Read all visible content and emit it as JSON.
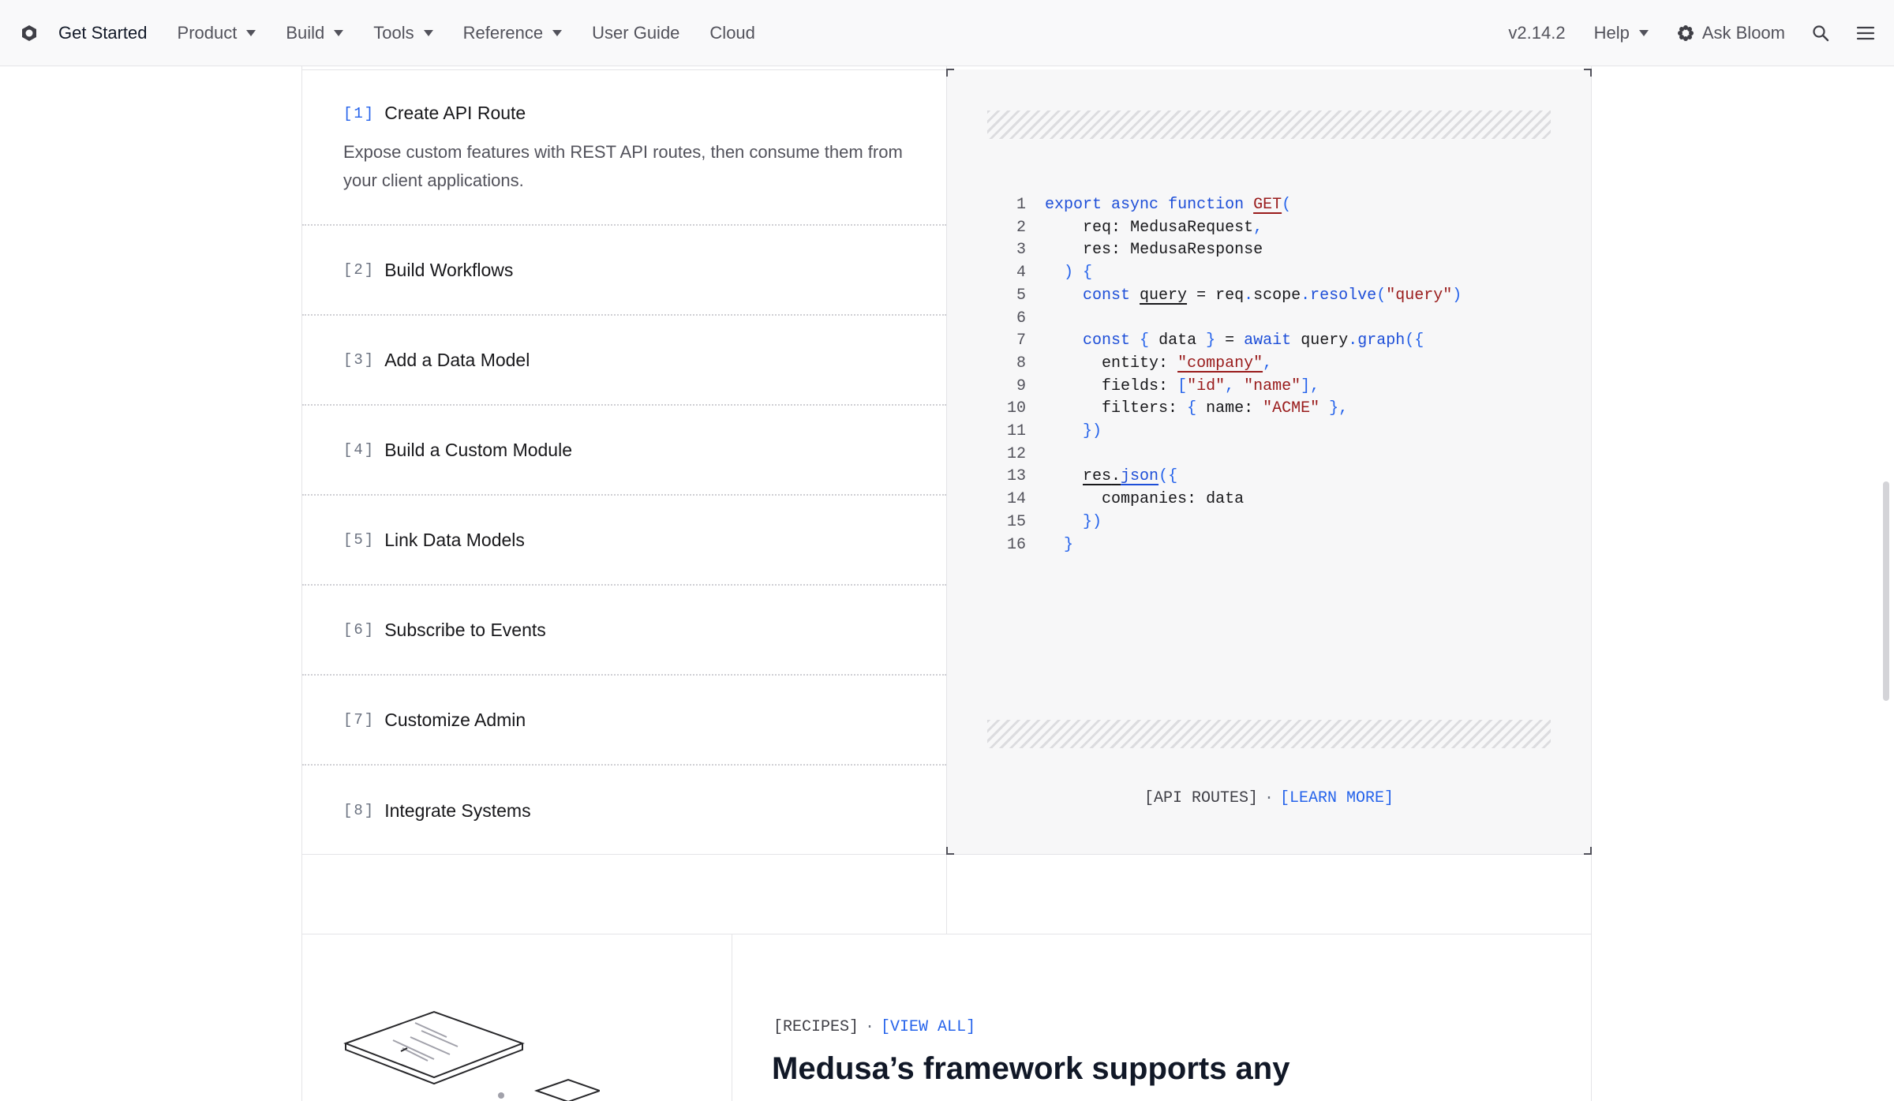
{
  "nav": {
    "left": [
      {
        "label": "Get Started",
        "active": true,
        "dropdown": false
      },
      {
        "label": "Product",
        "dropdown": true
      },
      {
        "label": "Build",
        "dropdown": true
      },
      {
        "label": "Tools",
        "dropdown": true
      },
      {
        "label": "Reference",
        "dropdown": true
      },
      {
        "label": "User Guide",
        "dropdown": false
      },
      {
        "label": "Cloud",
        "dropdown": false
      }
    ],
    "version": "v2.14.2",
    "help": "Help",
    "ask": "Ask Bloom",
    "icons": [
      "logo-icon",
      "caret-down-icon",
      "bloom-icon",
      "search-icon",
      "menu-icon"
    ]
  },
  "steps": [
    {
      "index": "[1]",
      "title": "Create API Route",
      "description": "Expose custom features with REST API routes, then consume them from your client applications."
    },
    {
      "index": "[2]",
      "title": "Build Workflows"
    },
    {
      "index": "[3]",
      "title": "Add a Data Model"
    },
    {
      "index": "[4]",
      "title": "Build a Custom Module"
    },
    {
      "index": "[5]",
      "title": "Link Data Models"
    },
    {
      "index": "[6]",
      "title": "Subscribe to Events"
    },
    {
      "index": "[7]",
      "title": "Customize Admin"
    },
    {
      "index": "[8]",
      "title": "Integrate Systems"
    }
  ],
  "code": {
    "line_numbers": [
      "1",
      "2",
      "3",
      "4",
      "5",
      "6",
      "7",
      "8",
      "9",
      "10",
      "11",
      "12",
      "13",
      "14",
      "15",
      "16"
    ],
    "lines": [
      "export async function GET(",
      "    req: MedusaRequest,",
      "    res: MedusaResponse",
      "  ) {",
      "    const query = req.scope.resolve(\"query\")",
      "",
      "    const { data } = await query.graph({",
      "      entity: \"company\",",
      "      fields: [\"id\", \"name\"],",
      "      filters: { name: \"ACME\" },",
      "    })",
      "",
      "    res.json({",
      "      companies: data",
      "    })",
      "  }"
    ],
    "footer_label": "[API ROUTES]",
    "footer_separator": "·",
    "footer_link": "[LEARN MORE]"
  },
  "recipes": {
    "label": "[RECIPES]",
    "separator": "·",
    "link": "[VIEW ALL]",
    "title": "Medusa’s framework supports any"
  },
  "colors": {
    "accent": "#2563eb",
    "string": "#991b1b",
    "keyword": "#1d4ed8",
    "panel": "#f7f7f8"
  }
}
